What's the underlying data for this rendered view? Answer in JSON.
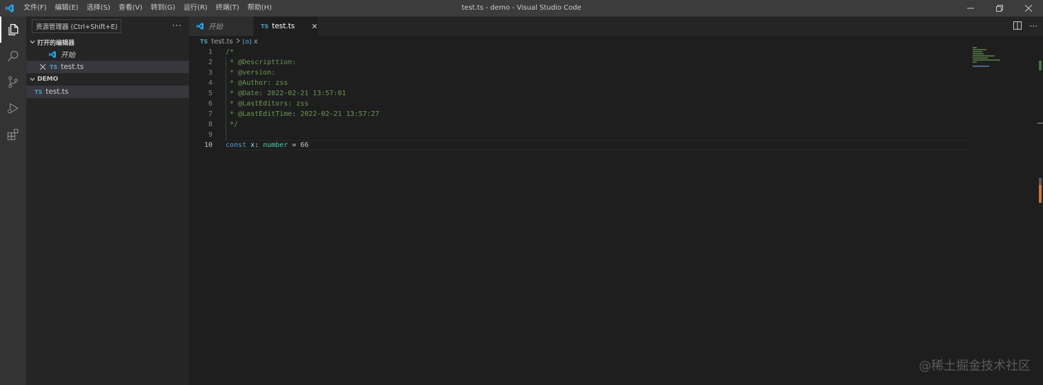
{
  "titlebar": {
    "menus": [
      "文件(F)",
      "编辑(E)",
      "选择(S)",
      "查看(V)",
      "转到(G)",
      "运行(R)",
      "终端(T)",
      "帮助(H)"
    ],
    "title": "test.ts - demo - Visual Studio Code"
  },
  "activitybar": {
    "items": [
      "explorer-icon",
      "search-icon",
      "source-control-icon",
      "run-debug-icon",
      "extensions-icon"
    ]
  },
  "sidebar": {
    "tooltip": "资源管理器 (Ctrl+Shift+E)",
    "open_editors_header": "打开的编辑器",
    "open_editors": [
      {
        "label": "开始",
        "icon": "vscode-icon"
      },
      {
        "label": "test.ts",
        "badge": "TS"
      }
    ],
    "folder_header": "DEMO",
    "files": [
      {
        "label": "test.ts",
        "badge": "TS"
      }
    ]
  },
  "editor": {
    "tabs": [
      {
        "label": "开始",
        "active": false
      },
      {
        "label": "test.ts",
        "badge": "TS",
        "active": true
      }
    ],
    "breadcrumb": {
      "file": "test.ts",
      "badge": "TS",
      "symbol_icon": "[⊙]",
      "symbol": "x"
    },
    "lines": [
      {
        "n": "1",
        "tokens": [
          [
            "cmt",
            "/*"
          ]
        ]
      },
      {
        "n": "2",
        "tokens": [
          [
            "cmt",
            " * @Descripttion:"
          ]
        ]
      },
      {
        "n": "3",
        "tokens": [
          [
            "cmt",
            " * @version:"
          ]
        ]
      },
      {
        "n": "4",
        "tokens": [
          [
            "cmt",
            " * @Author: zss"
          ]
        ]
      },
      {
        "n": "5",
        "tokens": [
          [
            "cmt",
            " * @Date: 2022-02-21 13:57:01"
          ]
        ]
      },
      {
        "n": "6",
        "tokens": [
          [
            "cmt",
            " * @LastEditors: zss"
          ]
        ]
      },
      {
        "n": "7",
        "tokens": [
          [
            "cmt",
            " * @LastEditTime: 2022-02-21 13:57:27"
          ]
        ]
      },
      {
        "n": "8",
        "tokens": [
          [
            "cmt",
            " */"
          ]
        ]
      },
      {
        "n": "9",
        "tokens": []
      },
      {
        "n": "10",
        "tokens": [
          [
            "kw",
            "const"
          ],
          [
            "plain",
            " "
          ],
          [
            "var",
            "x"
          ],
          [
            "plain",
            ": "
          ],
          [
            "type",
            "number"
          ],
          [
            "plain",
            " = "
          ],
          [
            "num",
            "66"
          ]
        ]
      }
    ],
    "current_line": 10
  },
  "watermark": "@稀土掘金技术社区",
  "colors": {
    "titlebar": "#3c3c3c",
    "activitybar": "#333333",
    "sidebar": "#252526",
    "editor": "#1e1e1e",
    "ts_badge": "#519aba",
    "vscode_blue": "#23a9f2"
  }
}
